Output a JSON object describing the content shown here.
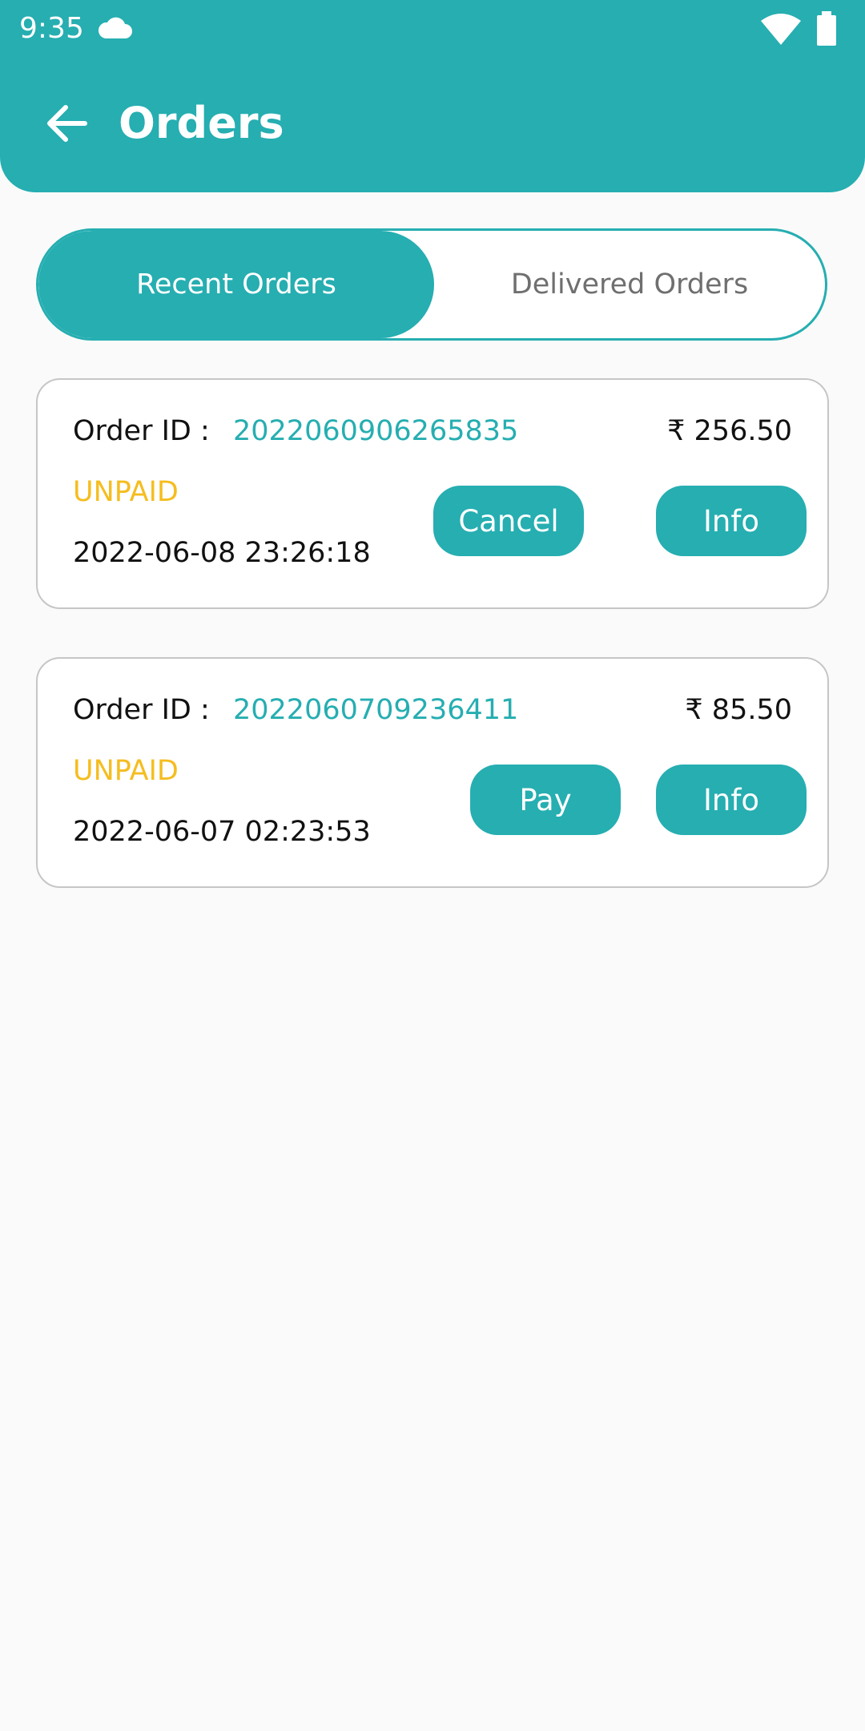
{
  "status_bar": {
    "time": "9:35"
  },
  "header": {
    "title": "Orders"
  },
  "tabs": [
    {
      "label": "Recent Orders",
      "active": true
    },
    {
      "label": "Delivered Orders",
      "active": false
    }
  ],
  "orders": [
    {
      "id_label": "Order ID :",
      "id": "2022060906265835",
      "amount": "₹ 256.50",
      "status": "UNPAID",
      "datetime": "2022-06-08 23:26:18",
      "action_label": "Cancel",
      "info_label": "Info"
    },
    {
      "id_label": "Order ID :",
      "id": "2022060709236411",
      "amount": "₹ 85.50",
      "status": "UNPAID",
      "datetime": "2022-06-07 02:23:53",
      "action_label": "Pay",
      "info_label": "Info"
    }
  ],
  "colors": {
    "accent": "#26aeb1",
    "unpaid": "#f5bd1f",
    "background": "#fafafa"
  }
}
